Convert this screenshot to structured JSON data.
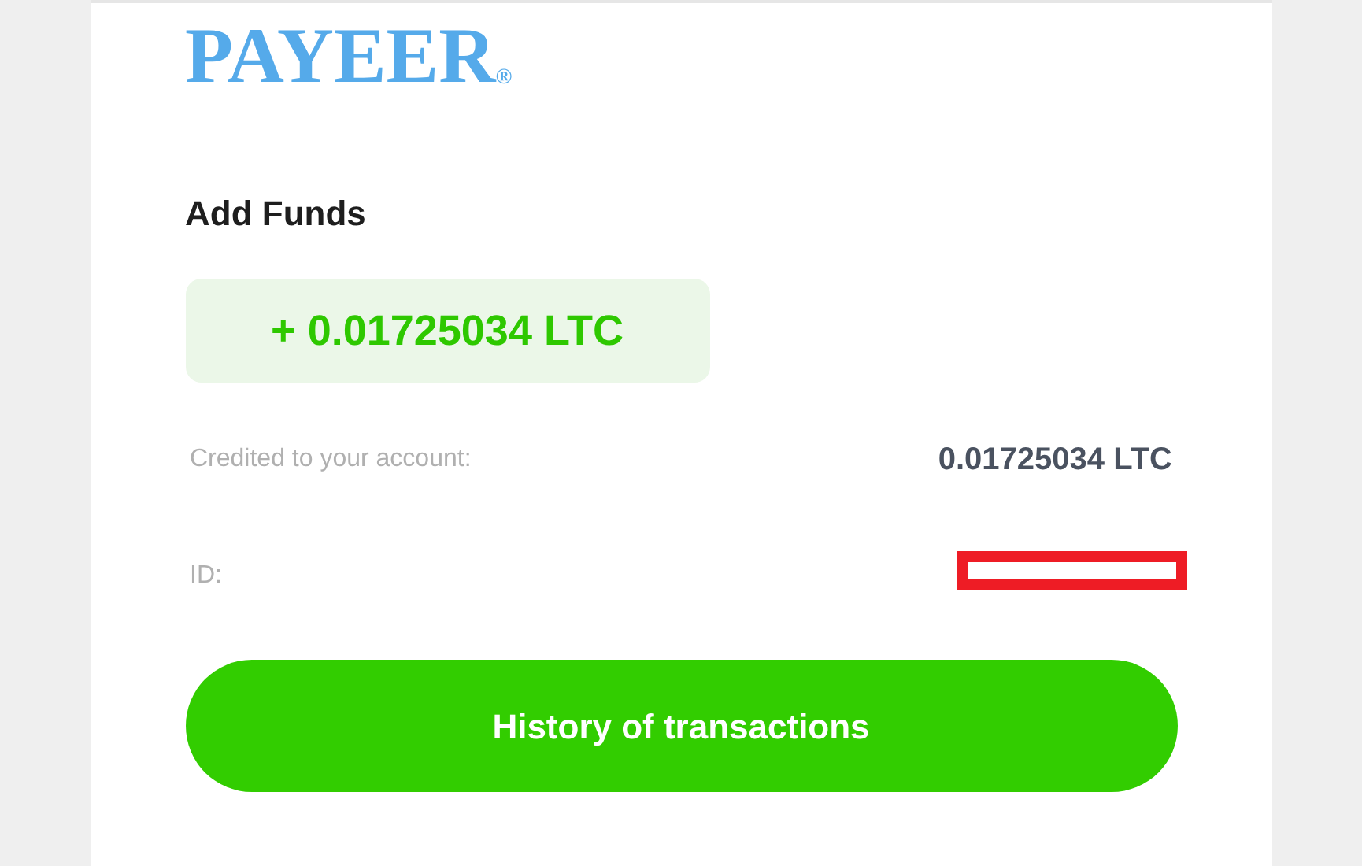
{
  "logo": {
    "name": "PAYEER",
    "mark": "®"
  },
  "title": "Add Funds",
  "amount_badge": "+ 0.01725034 LTC",
  "details": [
    {
      "label": "Credited to your account:",
      "value": "0.01725034 LTC",
      "kind": "text"
    },
    {
      "label": "ID:",
      "kind": "redacted"
    }
  ],
  "button": "History of transactions"
}
